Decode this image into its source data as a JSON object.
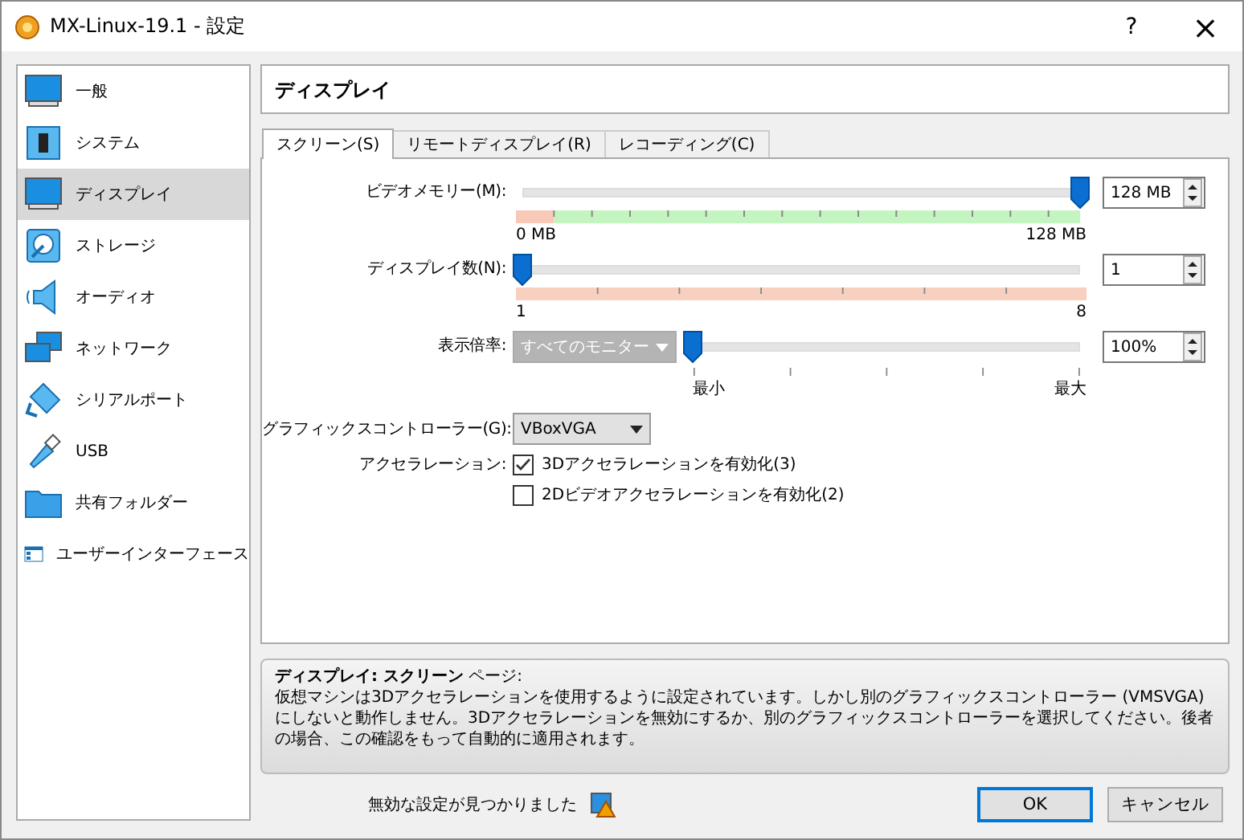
{
  "window": {
    "title": "MX-Linux-19.1 - 設定",
    "help": "?",
    "close": "×"
  },
  "sidebar": {
    "items": [
      {
        "label": "一般",
        "selected": false
      },
      {
        "label": "システム",
        "selected": false
      },
      {
        "label": "ディスプレイ",
        "selected": true
      },
      {
        "label": "ストレージ",
        "selected": false
      },
      {
        "label": "オーディオ",
        "selected": false
      },
      {
        "label": "ネットワーク",
        "selected": false
      },
      {
        "label": "シリアルポート",
        "selected": false
      },
      {
        "label": "USB",
        "selected": false
      },
      {
        "label": "共有フォルダー",
        "selected": false
      },
      {
        "label": "ユーザーインターフェース",
        "selected": false
      }
    ]
  },
  "page_title": "ディスプレイ",
  "tabs": [
    {
      "label": "スクリーン(S)",
      "selected": true
    },
    {
      "label": "リモートディスプレイ(R)",
      "selected": false
    },
    {
      "label": "レコーディング(C)",
      "selected": false
    }
  ],
  "video_memory": {
    "label": "ビデオメモリー(M):",
    "level": 1,
    "value": "128 MB",
    "min_label": "0 MB",
    "max_label": "128 MB"
  },
  "monitor_count": {
    "label": "ディスプレイ数(N):",
    "level": 0,
    "value": "1",
    "min_label": "1",
    "max_label": "8"
  },
  "scale_factor": {
    "label": "表示倍率:",
    "monitor_select": "すべてのモニター",
    "monitor_select_disabled": true,
    "level": 0,
    "value": "100%",
    "min_label": "最小",
    "max_label": "最大"
  },
  "graphics_controller": {
    "label": "グラフィックスコントローラー(G):",
    "value": "VBoxVGA"
  },
  "acceleration": {
    "label": "アクセラレーション:",
    "options": [
      {
        "label": "3Dアクセラレーションを有効化(3)",
        "checked": true
      },
      {
        "label": "2Dビデオアクセラレーションを有効化(2)",
        "checked": false
      }
    ]
  },
  "info": {
    "title": "**ディスプレイ: スクリーン** ページ:",
    "text": "仮想マシンは3Dアクセラレーションを使用するように設定されています。しかし別のグラフィックスコントローラー (VMSVGA) にしないと動作しません。3Dアクセラレーションを無効にするか、別のグラフィックスコントローラーを選択してください。後者の場合、この確認をもって自動的に適用されます。"
  },
  "status": {
    "message": "無効な設定が見つかりました"
  },
  "buttons": [
    {
      "label": "OK",
      "default": true
    },
    {
      "label": "キャンセル",
      "default": false
    }
  ]
}
